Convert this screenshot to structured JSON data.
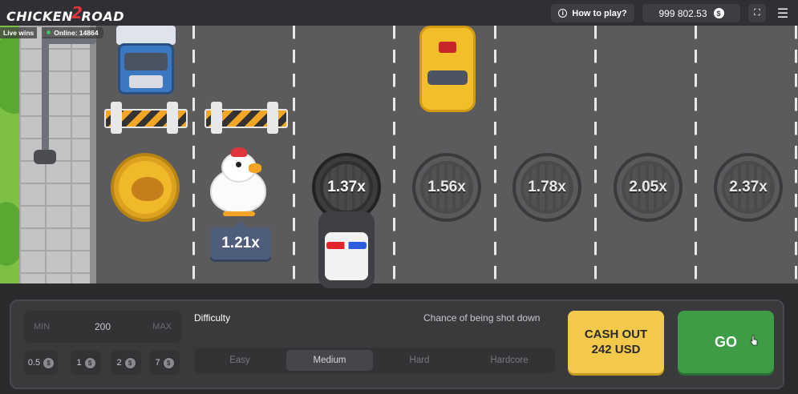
{
  "header": {
    "logo_text_left": "CHICKEN",
    "logo_text_mid": "2",
    "logo_text_right": "ROAD",
    "how_to_play_label": "How to play?",
    "balance": "999 802.53",
    "currency_symbol": "$"
  },
  "live": {
    "live_wins_label": "Live wins",
    "online_label": "Online: 14864"
  },
  "game": {
    "current_multiplier": "1.21x",
    "lanes": [
      {
        "multiplier": "1.37x",
        "state": "active"
      },
      {
        "multiplier": "1.56x",
        "state": "locked"
      },
      {
        "multiplier": "1.78x",
        "state": "locked"
      },
      {
        "multiplier": "2.05x",
        "state": "locked"
      },
      {
        "multiplier": "2.37x",
        "state": "locked"
      }
    ]
  },
  "bet": {
    "min_label": "MIN",
    "max_label": "MAX",
    "amount": "200",
    "quick_amounts": [
      "0.5",
      "1",
      "2",
      "7"
    ],
    "currency_symbol": "$"
  },
  "difficulty": {
    "label": "Difficulty",
    "chance_label": "Chance of being shot down",
    "options": [
      "Easy",
      "Medium",
      "Hard",
      "Hardcore"
    ],
    "selected": "Medium"
  },
  "actions": {
    "cashout_line1": "CASH OUT",
    "cashout_line2": "242 USD",
    "go_label": "GO"
  },
  "colors": {
    "accent_yellow": "#f3c94b",
    "go_green": "#3e9c47",
    "brand_red": "#e0353a"
  }
}
